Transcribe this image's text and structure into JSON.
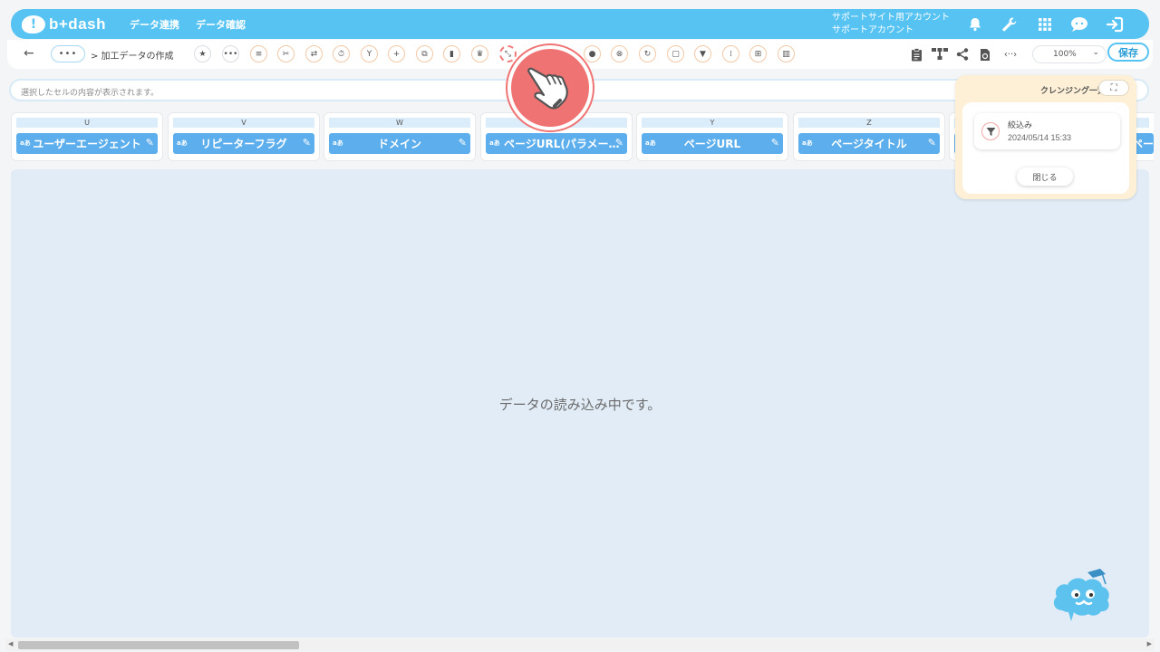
{
  "header": {
    "logo_text": "b+dash",
    "logo_mark": "!",
    "nav": [
      "データ連携",
      "データ確認"
    ],
    "account_line1": "サポートサイト用アカウント",
    "account_line2": "サポートアカウント",
    "icons": [
      "bell-icon",
      "wrench-icon",
      "grid-icon",
      "chat-bubble-icon",
      "logout-icon"
    ]
  },
  "toolbar": {
    "back": "←",
    "dots": "•••",
    "breadcrumb": "> 加工データの作成",
    "zoom_value": "100%",
    "save_label": "保存"
  },
  "cell_bar": {
    "placeholder": "選択したセルの内容が表示されます。"
  },
  "columns": [
    {
      "letter": "U",
      "name": "ユーザーエージェント",
      "type": "aあ"
    },
    {
      "letter": "V",
      "name": "リピーターフラグ",
      "type": "aあ"
    },
    {
      "letter": "W",
      "name": "ドメイン",
      "type": "aあ"
    },
    {
      "letter": "",
      "name": "ページURL(パラメー…",
      "type": "aあ"
    },
    {
      "letter": "Y",
      "name": "ページURL",
      "type": "aあ"
    },
    {
      "letter": "Z",
      "name": "ページタイトル",
      "type": "aあ"
    },
    {
      "letter": "",
      "name": "ペー",
      "type": ""
    }
  ],
  "main": {
    "loading_message": "データの読み込み中です。"
  },
  "cleansing": {
    "title": "クレンジング一覧",
    "item_name": "絞込み",
    "item_time": "2024/05/14 15:33",
    "close_label": "閉じる"
  },
  "colors": {
    "brand": "#56c3f2",
    "column_header": "#5daeec",
    "panel_bg": "#fdf0d6",
    "pointer": "#f07373"
  }
}
